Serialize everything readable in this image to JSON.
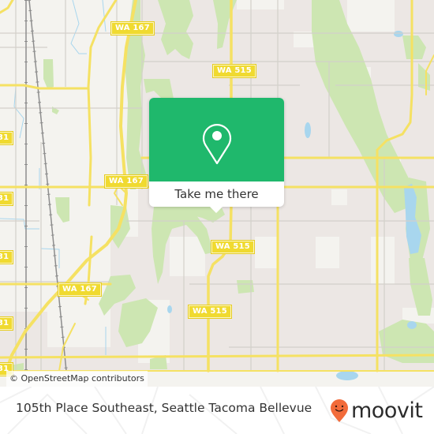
{
  "map": {
    "attribution": "© OpenStreetMap contributors",
    "road_shields": [
      {
        "label": "WA 167",
        "route": "WA 167"
      },
      {
        "label": "WA 515",
        "route": "WA 515"
      },
      {
        "label": "WA 167",
        "route": "WA 167"
      },
      {
        "label": "WA 515",
        "route": "WA 515"
      },
      {
        "label": "WA 167",
        "route": "WA 167"
      },
      {
        "label": "WA 515",
        "route": "WA 515"
      },
      {
        "label": "31",
        "route": "partially visible shield"
      },
      {
        "label": "31",
        "route": "partially visible shield"
      },
      {
        "label": "31",
        "route": "partially visible shield"
      },
      {
        "label": "31",
        "route": "partially visible shield"
      },
      {
        "label": "31",
        "route": "partially visible shield"
      }
    ],
    "colors": {
      "background": "#f4f3ef",
      "residential": "#ece7e4",
      "park": "#cde6b2",
      "water": "#a8d6ee",
      "major_road": "#f5e163",
      "minor_road": "#d3d0ca",
      "railway": "#8d8d8d"
    }
  },
  "popup": {
    "icon": "map-pin-icon",
    "cta_label": "Take me there",
    "accent_color": "#1fb86c"
  },
  "footer": {
    "location_title": "105th Place Southeast, Seattle Tacoma Bellevue",
    "brand_name": "moovit",
    "brand_icon": "moovit-smile-pin-icon",
    "brand_color": "#f26b3a"
  }
}
